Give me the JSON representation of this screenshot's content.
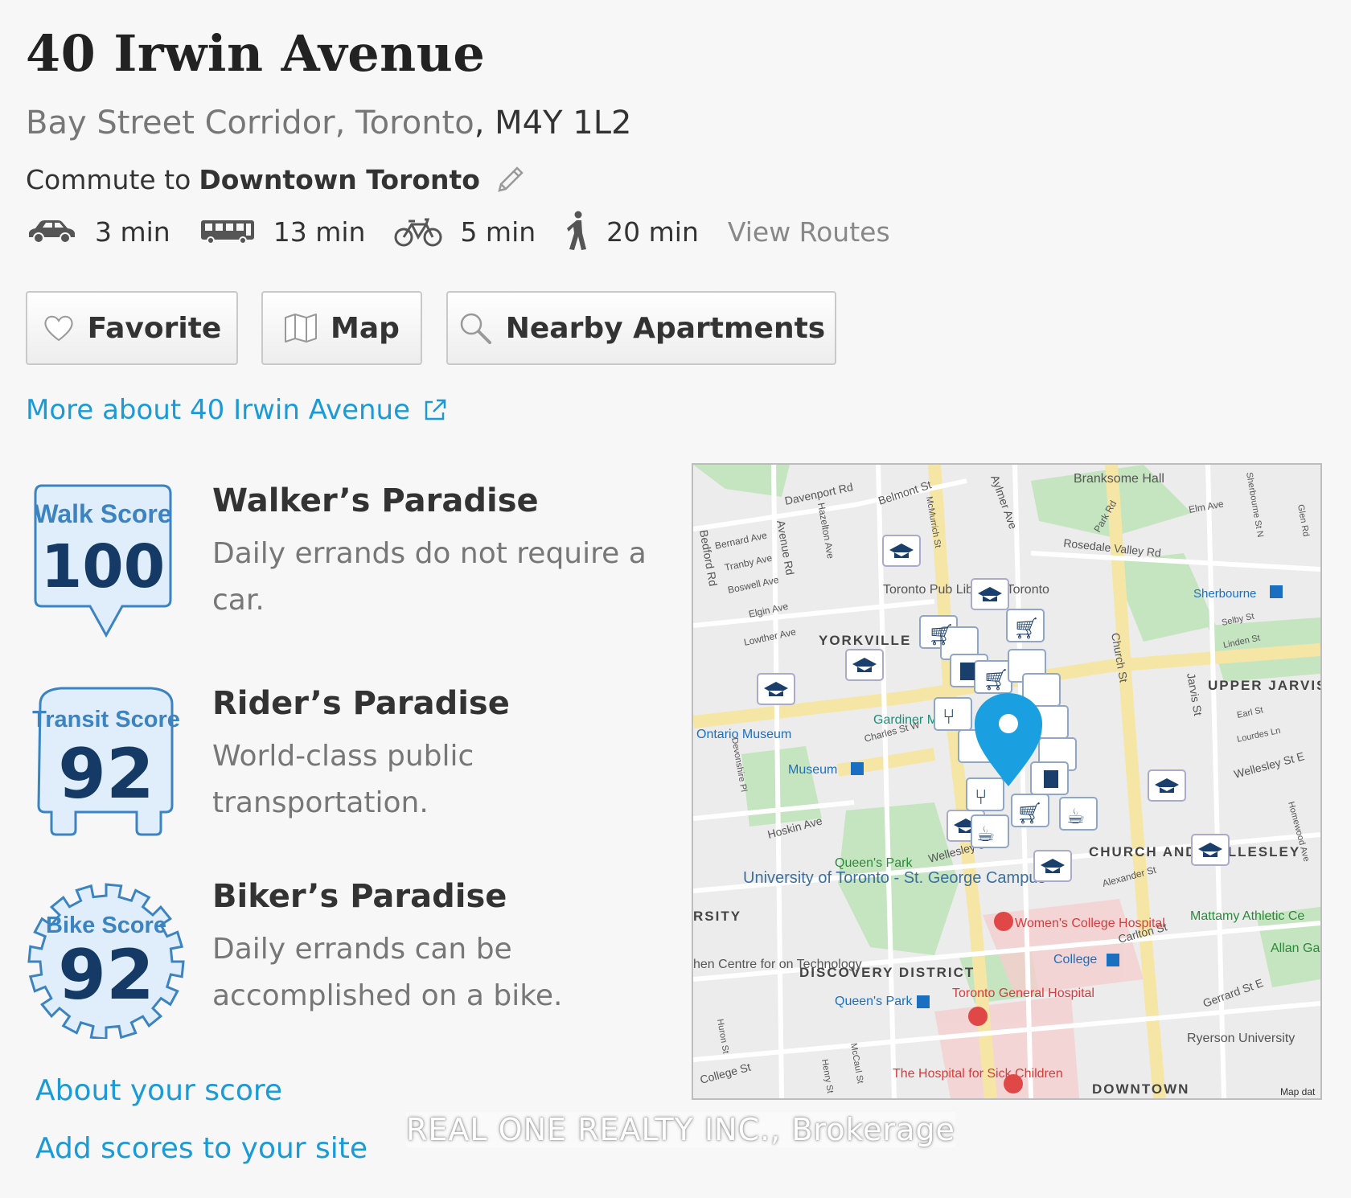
{
  "header": {
    "title": "40 Irwin Avenue",
    "neighborhood": "Bay Street Corridor, Toronto",
    "postal": ", M4Y 1L2"
  },
  "commute": {
    "prefix": "Commute to",
    "destination": "Downtown Toronto",
    "modes": [
      {
        "icon": "car-icon",
        "time": "3 min"
      },
      {
        "icon": "bus-icon",
        "time": "13 min"
      },
      {
        "icon": "bike-icon",
        "time": "5 min"
      },
      {
        "icon": "walk-icon",
        "time": "20 min"
      }
    ],
    "view_routes": "View Routes"
  },
  "buttons": {
    "favorite": "Favorite",
    "map": "Map",
    "nearby": "Nearby Apartments"
  },
  "more_link": "More about 40 Irwin Avenue",
  "scores": [
    {
      "label": "Walk Score",
      "value": "100",
      "title": "Walker’s Paradise",
      "desc": "Daily errands do not require a car."
    },
    {
      "label": "Transit Score",
      "value": "92",
      "title": "Rider’s Paradise",
      "desc": "World-class public transportation."
    },
    {
      "label": "Bike Score",
      "value": "92",
      "title": "Biker’s Paradise",
      "desc": "Daily errands can be accomplished on a bike."
    }
  ],
  "links": {
    "about": "About your score",
    "add": "Add scores to your site"
  },
  "map": {
    "streets": [
      "Davenport Rd",
      "Belmont St",
      "Aylmer Ave",
      "Branksome Hall",
      "Elm Ave",
      "Sherbourne St N",
      "Glen Rd",
      "Bedford Rd",
      "Bernard Ave",
      "Tranby Ave",
      "Boswell Ave",
      "Avenue Rd",
      "Hazelton Ave",
      "McMurrich St",
      "Park Rd",
      "Rosedale Valley Rd",
      "Elgin Ave",
      "Lowther Ave",
      "Sherbourne",
      "Selby St",
      "Linden St",
      "Church St",
      "Jarvis St",
      "Wellesley St E",
      "Wellesley St W",
      "Hoskin Ave",
      "Charles St W",
      "Devonshire Pl",
      "Alexander St",
      "Carlton St",
      "Gerrard St E",
      "College St",
      "Huron St",
      "McCaul St",
      "Henry St",
      "Earl St",
      "Lourdes Ln",
      "Homewood Ave"
    ],
    "places": {
      "yorkville": "YORKVILLE",
      "upper_jarvis": "UPPER JARVIS",
      "church_wellesley": "CHURCH AND WELLESLEY",
      "discovery": "DISCOVERY DISTRICT",
      "downtown": "DOWNTOWN",
      "ontario_museum": "Ontario Museum",
      "gardiner": "Gardiner M",
      "museum": "Museum",
      "queens_park": "Queen's Park",
      "queens_park_station": "Queen's Park",
      "uoft": "University of Toronto - St. George Campus",
      "library": "Toronto Pub Library - Toronto",
      "womens": "Women's College Hospital",
      "tgh": "Toronto General Hospital",
      "sick": "The Hospital for Sick Children",
      "college": "College",
      "ryerson": "Ryerson University",
      "mattamy": "Mattamy Athletic Ce",
      "allan": "Allan Ga",
      "centre": "hen Centre for on Technology",
      "rsity": "RSITY",
      "map_data": "Map dat"
    },
    "colors": {
      "land": "#ececec",
      "park": "#c5e5c0",
      "pin": "#1aa0e0",
      "marker": "#1b3f6b"
    }
  },
  "watermark": "REAL ONE REALTY INC., Brokerage"
}
